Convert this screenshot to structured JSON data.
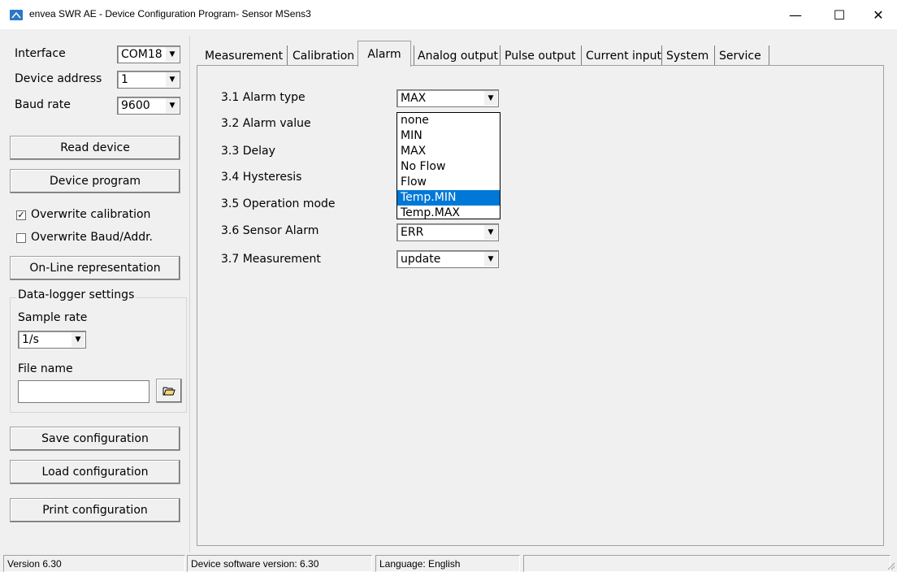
{
  "window": {
    "title": "envea SWR AE - Device Configuration Program- Sensor MSens3",
    "minimize_glyph": "—",
    "maximize_glyph": "☐",
    "close_glyph": "✕"
  },
  "left": {
    "interface_label": "Interface",
    "interface_value": "COM18",
    "device_address_label": "Device address",
    "device_address_value": "1",
    "baud_rate_label": "Baud rate",
    "baud_rate_value": "9600",
    "read_device": "Read device",
    "device_program": "Device program",
    "overwrite_calibration": "Overwrite calibration",
    "overwrite_calibration_checked": true,
    "overwrite_baud": "Overwrite Baud/Addr.",
    "overwrite_baud_checked": false,
    "online_representation": "On-Line representation",
    "datalogger": {
      "title": "Data-logger settings",
      "sample_rate_label": "Sample rate",
      "sample_rate_value": "1/s",
      "file_name_label": "File name",
      "file_name_value": ""
    },
    "save_configuration": "Save configuration",
    "load_configuration": "Load configuration",
    "print_configuration": "Print configuration"
  },
  "tabs": [
    {
      "label": "Measurement"
    },
    {
      "label": "Calibration"
    },
    {
      "label": "Alarm"
    },
    {
      "label": "Analog output"
    },
    {
      "label": "Pulse output"
    },
    {
      "label": "Current input"
    },
    {
      "label": "System"
    },
    {
      "label": "Service"
    }
  ],
  "active_tab": "Alarm",
  "alarm": {
    "alarm_type_label": "3.1 Alarm type",
    "alarm_type_value": "MAX",
    "alarm_value_label": "3.2 Alarm value",
    "delay_label": "3.3 Delay",
    "hysteresis_label": "3.4 Hysteresis",
    "operation_mode_label": "3.5 Operation mode",
    "sensor_alarm_label": "3.6 Sensor Alarm",
    "sensor_alarm_value": "ERR",
    "measurement_label": "3.7 Measurement",
    "measurement_value": "update",
    "dropdown_options": [
      "none",
      "MIN",
      "MAX",
      "No Flow",
      "Flow",
      "Temp.MIN",
      "Temp.MAX"
    ],
    "dropdown_selected": "Temp.MIN"
  },
  "status": {
    "version": "Version 6.30",
    "device_software": "Device software version: 6.30",
    "language": "Language: English"
  },
  "colors": {
    "selection": "#0078d7",
    "app_icon": "#2b78c5"
  }
}
